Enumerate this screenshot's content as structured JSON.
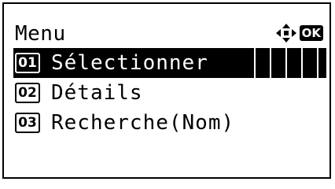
{
  "header": {
    "title": "Menu",
    "nav_icon": "four-way-arrow-icon",
    "ok_label": "OK"
  },
  "menu": {
    "items": [
      {
        "number": "01",
        "label": "Sélectionner",
        "selected": true
      },
      {
        "number": "02",
        "label": "Détails",
        "selected": false
      },
      {
        "number": "03",
        "label": "Recherche(Nom)",
        "selected": false
      }
    ]
  },
  "colors": {
    "background": "#ffffff",
    "foreground": "#000000"
  }
}
